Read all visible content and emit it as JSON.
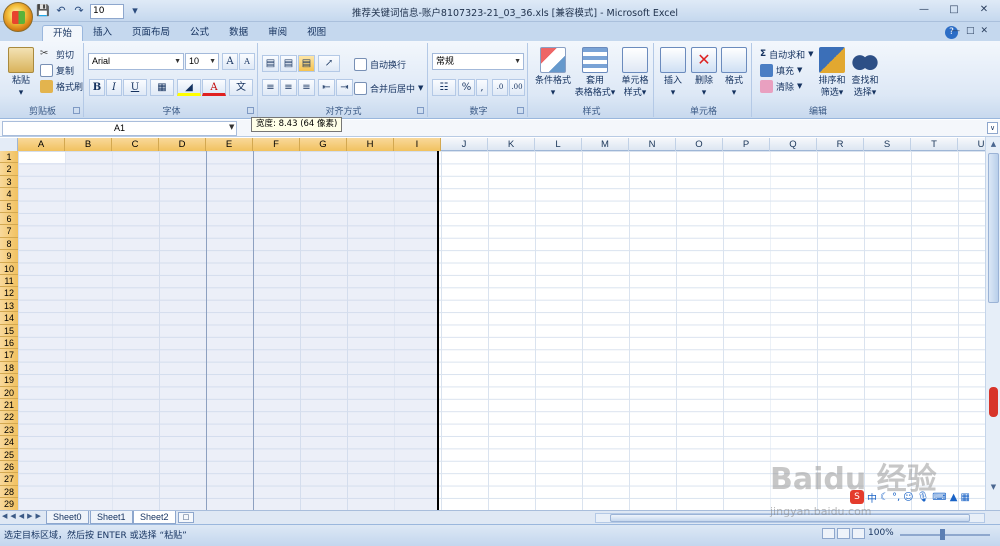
{
  "window": {
    "title": "推荐关键词信息-账户8107323-21_03_36.xls  [兼容模式] - Microsoft Excel",
    "qat_font_size": "10"
  },
  "tabs": [
    "开始",
    "插入",
    "页面布局",
    "公式",
    "数据",
    "审阅",
    "视图"
  ],
  "ribbon": {
    "clipboard": {
      "label": "剪贴板",
      "paste": "粘贴",
      "cut": "剪切",
      "copy": "复制",
      "format_painter": "格式刷"
    },
    "font": {
      "label": "字体",
      "font_name": "Arial",
      "font_size": "10",
      "bold": "B",
      "italic": "I",
      "underline": "U",
      "grow": "A",
      "shrink": "A",
      "wen": "文"
    },
    "alignment": {
      "label": "对齐方式",
      "wrap_text": "自动换行",
      "merge_center": "合并后居中"
    },
    "number": {
      "label": "数字",
      "format": "常规",
      "percent": "%",
      "comma": ","
    },
    "styles": {
      "label": "样式",
      "conditional": "条件格式",
      "table_format_1": "套用",
      "table_format_2": "表格格式",
      "cell_styles_1": "单元格",
      "cell_styles_2": "样式"
    },
    "cells": {
      "label": "单元格",
      "insert": "插入",
      "delete": "删除",
      "format": "格式"
    },
    "editing": {
      "label": "编辑",
      "autosum": "自动求和",
      "fill": "填充",
      "clear": "清除",
      "sort_1": "排序和",
      "sort_2": "筛选",
      "find_1": "查找和",
      "find_2": "选择"
    }
  },
  "formula_bar": {
    "name_box": "A1",
    "tooltip": "宽度: 8.43 (64 像素)"
  },
  "columns": [
    "A",
    "B",
    "C",
    "D",
    "E",
    "F",
    "G",
    "H",
    "I",
    "J",
    "K",
    "L",
    "M",
    "N",
    "O",
    "P",
    "Q",
    "R",
    "S",
    "T",
    "U"
  ],
  "rows": [
    "1",
    "2",
    "3",
    "4",
    "5",
    "6",
    "7",
    "8",
    "9",
    "10",
    "11",
    "12",
    "13",
    "14",
    "15",
    "16",
    "17",
    "18",
    "19",
    "20",
    "21",
    "22",
    "23",
    "24",
    "25",
    "26",
    "27",
    "28",
    "29"
  ],
  "sheets": [
    "Sheet0",
    "Sheet1",
    "Sheet2"
  ],
  "status": {
    "text": "选定目标区域，然后按 ENTER 或选择 “粘贴”",
    "zoom": "100%"
  },
  "ime": {
    "label": "中"
  },
  "watermark": {
    "text": "Baidu 经验",
    "url": "jingyan.baidu.com"
  }
}
